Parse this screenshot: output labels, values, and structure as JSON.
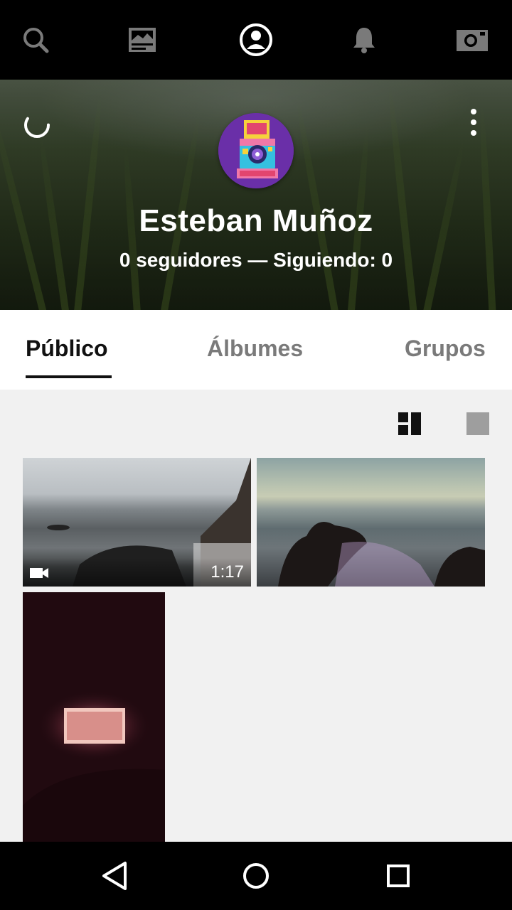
{
  "top_nav": {
    "items": [
      {
        "icon": "search-icon"
      },
      {
        "icon": "feed-icon"
      },
      {
        "icon": "profile-icon",
        "active": true
      },
      {
        "icon": "bell-icon"
      },
      {
        "icon": "camera-icon"
      }
    ],
    "colors": {
      "active": "#ffffff",
      "inactive": "#7a7a7a"
    }
  },
  "profile": {
    "name": "Esteban Muñoz",
    "stats": "0 seguidores — Siguiendo: 0",
    "avatar_icon": "polaroid-camera-avatar"
  },
  "tabs": [
    {
      "label": "Público",
      "active": true
    },
    {
      "label": "Álbumes",
      "active": false
    },
    {
      "label": "Grupos",
      "active": false
    }
  ],
  "view_toggle": {
    "options": [
      "grid-view-icon",
      "single-view-icon"
    ],
    "selected": "grid-view-icon"
  },
  "gallery": {
    "items": [
      {
        "type": "video",
        "duration": "1:17"
      },
      {
        "type": "photo"
      },
      {
        "type": "photo"
      }
    ]
  },
  "system_nav": {
    "items": [
      "back-icon",
      "home-icon",
      "recents-icon"
    ]
  }
}
